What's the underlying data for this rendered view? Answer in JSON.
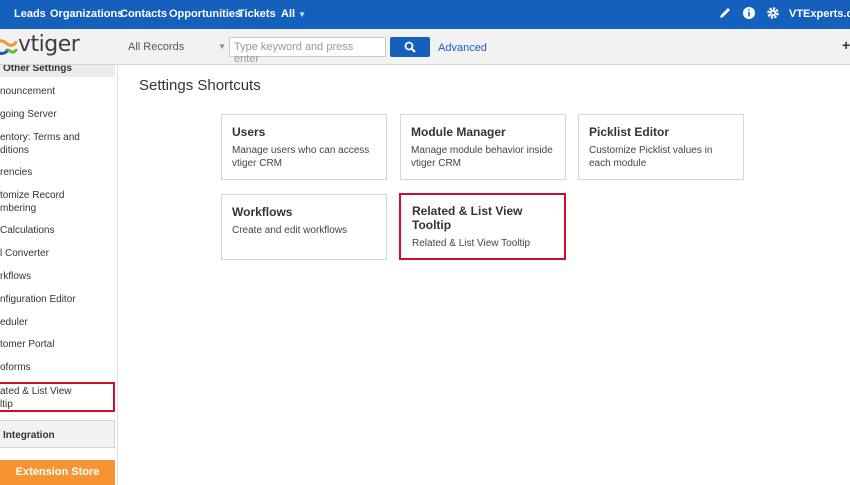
{
  "topnav": {
    "items": [
      "Leads",
      "Organizations",
      "Contacts",
      "Opportunities",
      "Tickets",
      "All"
    ],
    "user": "VTExperts.com",
    "bg": "#1560bd"
  },
  "header": {
    "logo": "vtiger",
    "select_value": "All Records",
    "search_placeholder": "Type keyword and press enter",
    "advanced_label": "Advanced",
    "plus": "+"
  },
  "sidebar": {
    "section_title": "Other Settings",
    "items": [
      "nouncement",
      "going Server",
      "entory: Terms and",
      "ditions",
      "rencies",
      "tomize Record",
      "mbering",
      "Calculations",
      "l Converter",
      "rkflows",
      "nfiguration Editor",
      "eduler",
      "tomer Portal",
      "oforms",
      "ated & List View",
      "ltip"
    ],
    "integration_label": "Integration",
    "store_label": "Extension Store"
  },
  "main": {
    "title": "Settings Shortcuts",
    "cards": [
      {
        "title": "Users",
        "desc": "Manage users who can access vtiger CRM"
      },
      {
        "title": "Module Manager",
        "desc": "Manage module behavior inside vtiger CRM"
      },
      {
        "title": "Picklist Editor",
        "desc": "Customize Picklist values in each module"
      },
      {
        "title": "Workflows",
        "desc": "Create and edit workflows"
      },
      {
        "title": "Related & List View Tooltip",
        "desc": "Related & List View Tooltip"
      }
    ]
  },
  "colors": {
    "accent": "#1560bd",
    "highlight": "#c8102e",
    "store": "#f79432"
  }
}
